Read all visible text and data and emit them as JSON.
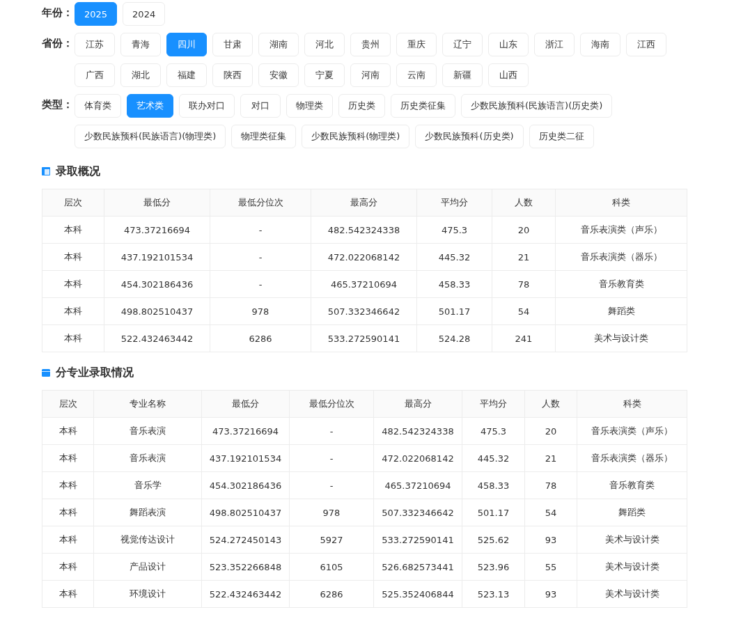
{
  "filters": [
    {
      "label": "年份：",
      "options": [
        {
          "text": "2025",
          "selected": true
        },
        {
          "text": "2024",
          "selected": false
        }
      ]
    },
    {
      "label": "省份：",
      "options": [
        {
          "text": "江苏",
          "selected": false
        },
        {
          "text": "青海",
          "selected": false
        },
        {
          "text": "四川",
          "selected": true
        },
        {
          "text": "甘肃",
          "selected": false
        },
        {
          "text": "湖南",
          "selected": false
        },
        {
          "text": "河北",
          "selected": false
        },
        {
          "text": "贵州",
          "selected": false
        },
        {
          "text": "重庆",
          "selected": false
        },
        {
          "text": "辽宁",
          "selected": false
        },
        {
          "text": "山东",
          "selected": false
        },
        {
          "text": "浙江",
          "selected": false
        },
        {
          "text": "海南",
          "selected": false
        },
        {
          "text": "江西",
          "selected": false
        },
        {
          "text": "广西",
          "selected": false
        },
        {
          "text": "湖北",
          "selected": false
        },
        {
          "text": "福建",
          "selected": false
        },
        {
          "text": "陕西",
          "selected": false
        },
        {
          "text": "安徽",
          "selected": false
        },
        {
          "text": "宁夏",
          "selected": false
        },
        {
          "text": "河南",
          "selected": false
        },
        {
          "text": "云南",
          "selected": false
        },
        {
          "text": "新疆",
          "selected": false
        },
        {
          "text": "山西",
          "selected": false
        }
      ]
    },
    {
      "label": "类型：",
      "options": [
        {
          "text": "体育类",
          "selected": false
        },
        {
          "text": "艺术类",
          "selected": true
        },
        {
          "text": "联办对口",
          "selected": false
        },
        {
          "text": "对口",
          "selected": false
        },
        {
          "text": "物理类",
          "selected": false
        },
        {
          "text": "历史类",
          "selected": false
        },
        {
          "text": "历史类征集",
          "selected": false
        },
        {
          "text": "少数民族预科(民族语言)(历史类)",
          "selected": false
        },
        {
          "text": "少数民族预科(民族语言)(物理类)",
          "selected": false
        },
        {
          "text": "物理类征集",
          "selected": false
        },
        {
          "text": "少数民族预科(物理类)",
          "selected": false
        },
        {
          "text": "少数民族预科(历史类)",
          "selected": false
        },
        {
          "text": "历史类二征",
          "selected": false
        }
      ]
    }
  ],
  "sections": [
    {
      "title": "录取概况",
      "kind": "overview",
      "columns": [
        "层次",
        "最低分",
        "最低分位次",
        "最高分",
        "平均分",
        "人数",
        "科类"
      ],
      "rows": [
        [
          "本科",
          "473.37216694",
          "-",
          "482.542324338",
          "475.3",
          "20",
          "音乐表演类（声乐）"
        ],
        [
          "本科",
          "437.192101534",
          "-",
          "472.022068142",
          "445.32",
          "21",
          "音乐表演类（器乐）"
        ],
        [
          "本科",
          "454.302186436",
          "-",
          "465.37210694",
          "458.33",
          "78",
          "音乐教育类"
        ],
        [
          "本科",
          "498.802510437",
          "978",
          "507.332346642",
          "501.17",
          "54",
          "舞蹈类"
        ],
        [
          "本科",
          "522.432463442",
          "6286",
          "533.272590141",
          "524.28",
          "241",
          "美术与设计类"
        ]
      ]
    },
    {
      "title": "分专业录取情况",
      "kind": "major",
      "columns": [
        "层次",
        "专业名称",
        "最低分",
        "最低分位次",
        "最高分",
        "平均分",
        "人数",
        "科类"
      ],
      "rows": [
        [
          "本科",
          "音乐表演",
          "473.37216694",
          "-",
          "482.542324338",
          "475.3",
          "20",
          "音乐表演类（声乐）"
        ],
        [
          "本科",
          "音乐表演",
          "437.192101534",
          "-",
          "472.022068142",
          "445.32",
          "21",
          "音乐表演类（器乐）"
        ],
        [
          "本科",
          "音乐学",
          "454.302186436",
          "-",
          "465.37210694",
          "458.33",
          "78",
          "音乐教育类"
        ],
        [
          "本科",
          "舞蹈表演",
          "498.802510437",
          "978",
          "507.332346642",
          "501.17",
          "54",
          "舞蹈类"
        ],
        [
          "本科",
          "视觉传达设计",
          "524.272450143",
          "5927",
          "533.272590141",
          "525.62",
          "93",
          "美术与设计类"
        ],
        [
          "本科",
          "产品设计",
          "523.352266848",
          "6105",
          "526.682573441",
          "523.96",
          "55",
          "美术与设计类"
        ],
        [
          "本科",
          "环境设计",
          "522.432463442",
          "6286",
          "525.352406844",
          "523.13",
          "93",
          "美术与设计类"
        ]
      ]
    }
  ]
}
